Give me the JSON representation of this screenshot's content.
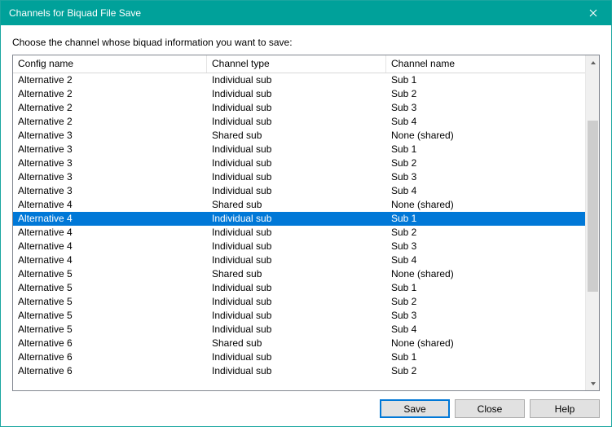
{
  "window": {
    "title": "Channels for Biquad File Save"
  },
  "instruction": "Choose the channel whose biquad information you want to save:",
  "columns": {
    "config": "Config name",
    "type": "Channel type",
    "name": "Channel name"
  },
  "rows": [
    {
      "config": "Alternative 2",
      "type": "Individual sub",
      "name": "Sub 1",
      "selected": false
    },
    {
      "config": "Alternative 2",
      "type": "Individual sub",
      "name": "Sub 2",
      "selected": false
    },
    {
      "config": "Alternative 2",
      "type": "Individual sub",
      "name": "Sub 3",
      "selected": false
    },
    {
      "config": "Alternative 2",
      "type": "Individual sub",
      "name": "Sub 4",
      "selected": false
    },
    {
      "config": "Alternative 3",
      "type": "Shared sub",
      "name": "None (shared)",
      "selected": false
    },
    {
      "config": "Alternative 3",
      "type": "Individual sub",
      "name": "Sub 1",
      "selected": false
    },
    {
      "config": "Alternative 3",
      "type": "Individual sub",
      "name": "Sub 2",
      "selected": false
    },
    {
      "config": "Alternative 3",
      "type": "Individual sub",
      "name": "Sub 3",
      "selected": false
    },
    {
      "config": "Alternative 3",
      "type": "Individual sub",
      "name": "Sub 4",
      "selected": false
    },
    {
      "config": "Alternative 4",
      "type": "Shared sub",
      "name": "None (shared)",
      "selected": false
    },
    {
      "config": "Alternative 4",
      "type": "Individual sub",
      "name": "Sub 1",
      "selected": true
    },
    {
      "config": "Alternative 4",
      "type": "Individual sub",
      "name": "Sub 2",
      "selected": false
    },
    {
      "config": "Alternative 4",
      "type": "Individual sub",
      "name": "Sub 3",
      "selected": false
    },
    {
      "config": "Alternative 4",
      "type": "Individual sub",
      "name": "Sub 4",
      "selected": false
    },
    {
      "config": "Alternative 5",
      "type": "Shared sub",
      "name": "None (shared)",
      "selected": false
    },
    {
      "config": "Alternative 5",
      "type": "Individual sub",
      "name": "Sub 1",
      "selected": false
    },
    {
      "config": "Alternative 5",
      "type": "Individual sub",
      "name": "Sub 2",
      "selected": false
    },
    {
      "config": "Alternative 5",
      "type": "Individual sub",
      "name": "Sub 3",
      "selected": false
    },
    {
      "config": "Alternative 5",
      "type": "Individual sub",
      "name": "Sub 4",
      "selected": false
    },
    {
      "config": "Alternative 6",
      "type": "Shared sub",
      "name": "None (shared)",
      "selected": false
    },
    {
      "config": "Alternative 6",
      "type": "Individual sub",
      "name": "Sub 1",
      "selected": false
    },
    {
      "config": "Alternative 6",
      "type": "Individual sub",
      "name": "Sub 2",
      "selected": false
    }
  ],
  "buttons": {
    "save": "Save",
    "close": "Close",
    "help": "Help"
  }
}
